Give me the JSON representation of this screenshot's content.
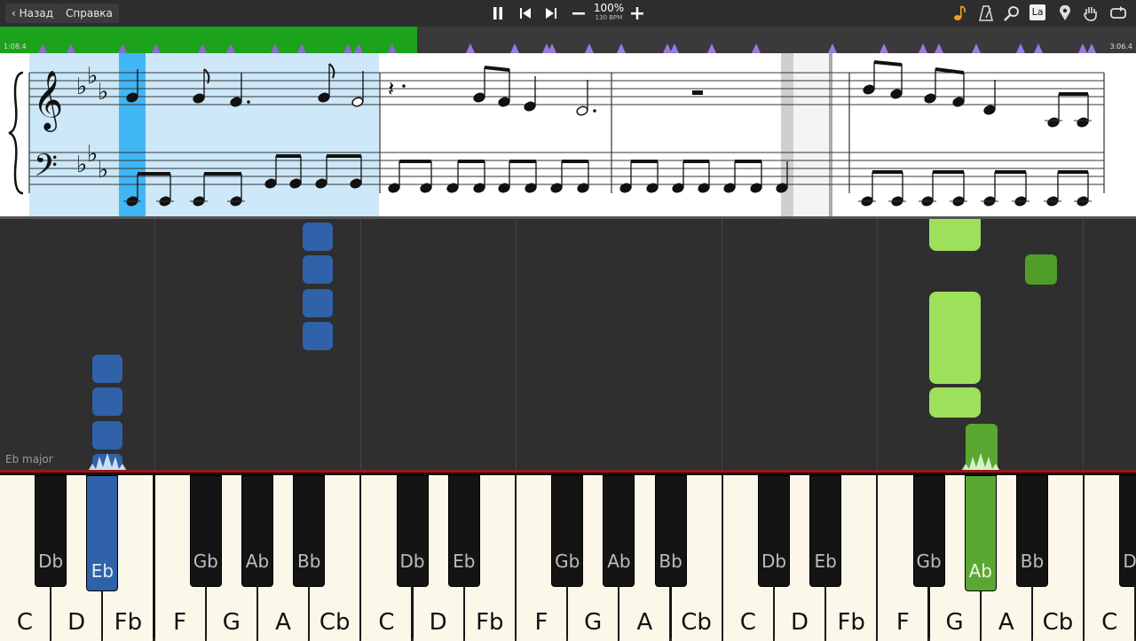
{
  "topbar": {
    "back_label": "Назад",
    "help_label": "Справка",
    "zoom_text": "100%",
    "tempo_text": "130 BPM",
    "icons": [
      "pause-icon",
      "skip-back-icon",
      "skip-forward-icon",
      "zoom-out-icon",
      "zoom-in-icon",
      "note-icon",
      "metronome-icon",
      "search-icon",
      "note-name-icon",
      "marker-icon",
      "hand-icon",
      "loop-icon"
    ],
    "note_name_label": "La"
  },
  "timeline": {
    "start_time": "1:08.4",
    "end_time": "3:06.4",
    "progress": 0.367
  },
  "roll": {
    "key_signature": "Eb major"
  },
  "keyboard": {
    "white_keys": [
      "C",
      "D",
      "Fb",
      "F",
      "G",
      "A",
      "Cb",
      "C",
      "D",
      "Fb",
      "F",
      "G",
      "A",
      "Cb",
      "C",
      "D",
      "Fb",
      "F",
      "G",
      "A",
      "Cb",
      "C"
    ],
    "black_keys": [
      {
        "label": "Db",
        "state": "normal"
      },
      {
        "label": "Eb",
        "state": "blue"
      },
      {
        "label": "Gb",
        "state": "normal"
      },
      {
        "label": "Ab",
        "state": "normal"
      },
      {
        "label": "Bb",
        "state": "normal"
      },
      {
        "label": "Db",
        "state": "normal"
      },
      {
        "label": "Eb",
        "state": "normal"
      },
      {
        "label": "Gb",
        "state": "normal"
      },
      {
        "label": "Ab",
        "state": "normal"
      },
      {
        "label": "Bb",
        "state": "normal"
      },
      {
        "label": "Db",
        "state": "normal"
      },
      {
        "label": "Eb",
        "state": "normal"
      },
      {
        "label": "Gb",
        "state": "normal"
      },
      {
        "label": "Ab",
        "state": "green"
      },
      {
        "label": "Bb",
        "state": "normal"
      },
      {
        "label": "Db",
        "state": "normal"
      }
    ],
    "colors": {
      "left_hand": "#2f62a8",
      "right_hand": "#5aa832",
      "right_hand_light": "#9ee05c"
    }
  }
}
